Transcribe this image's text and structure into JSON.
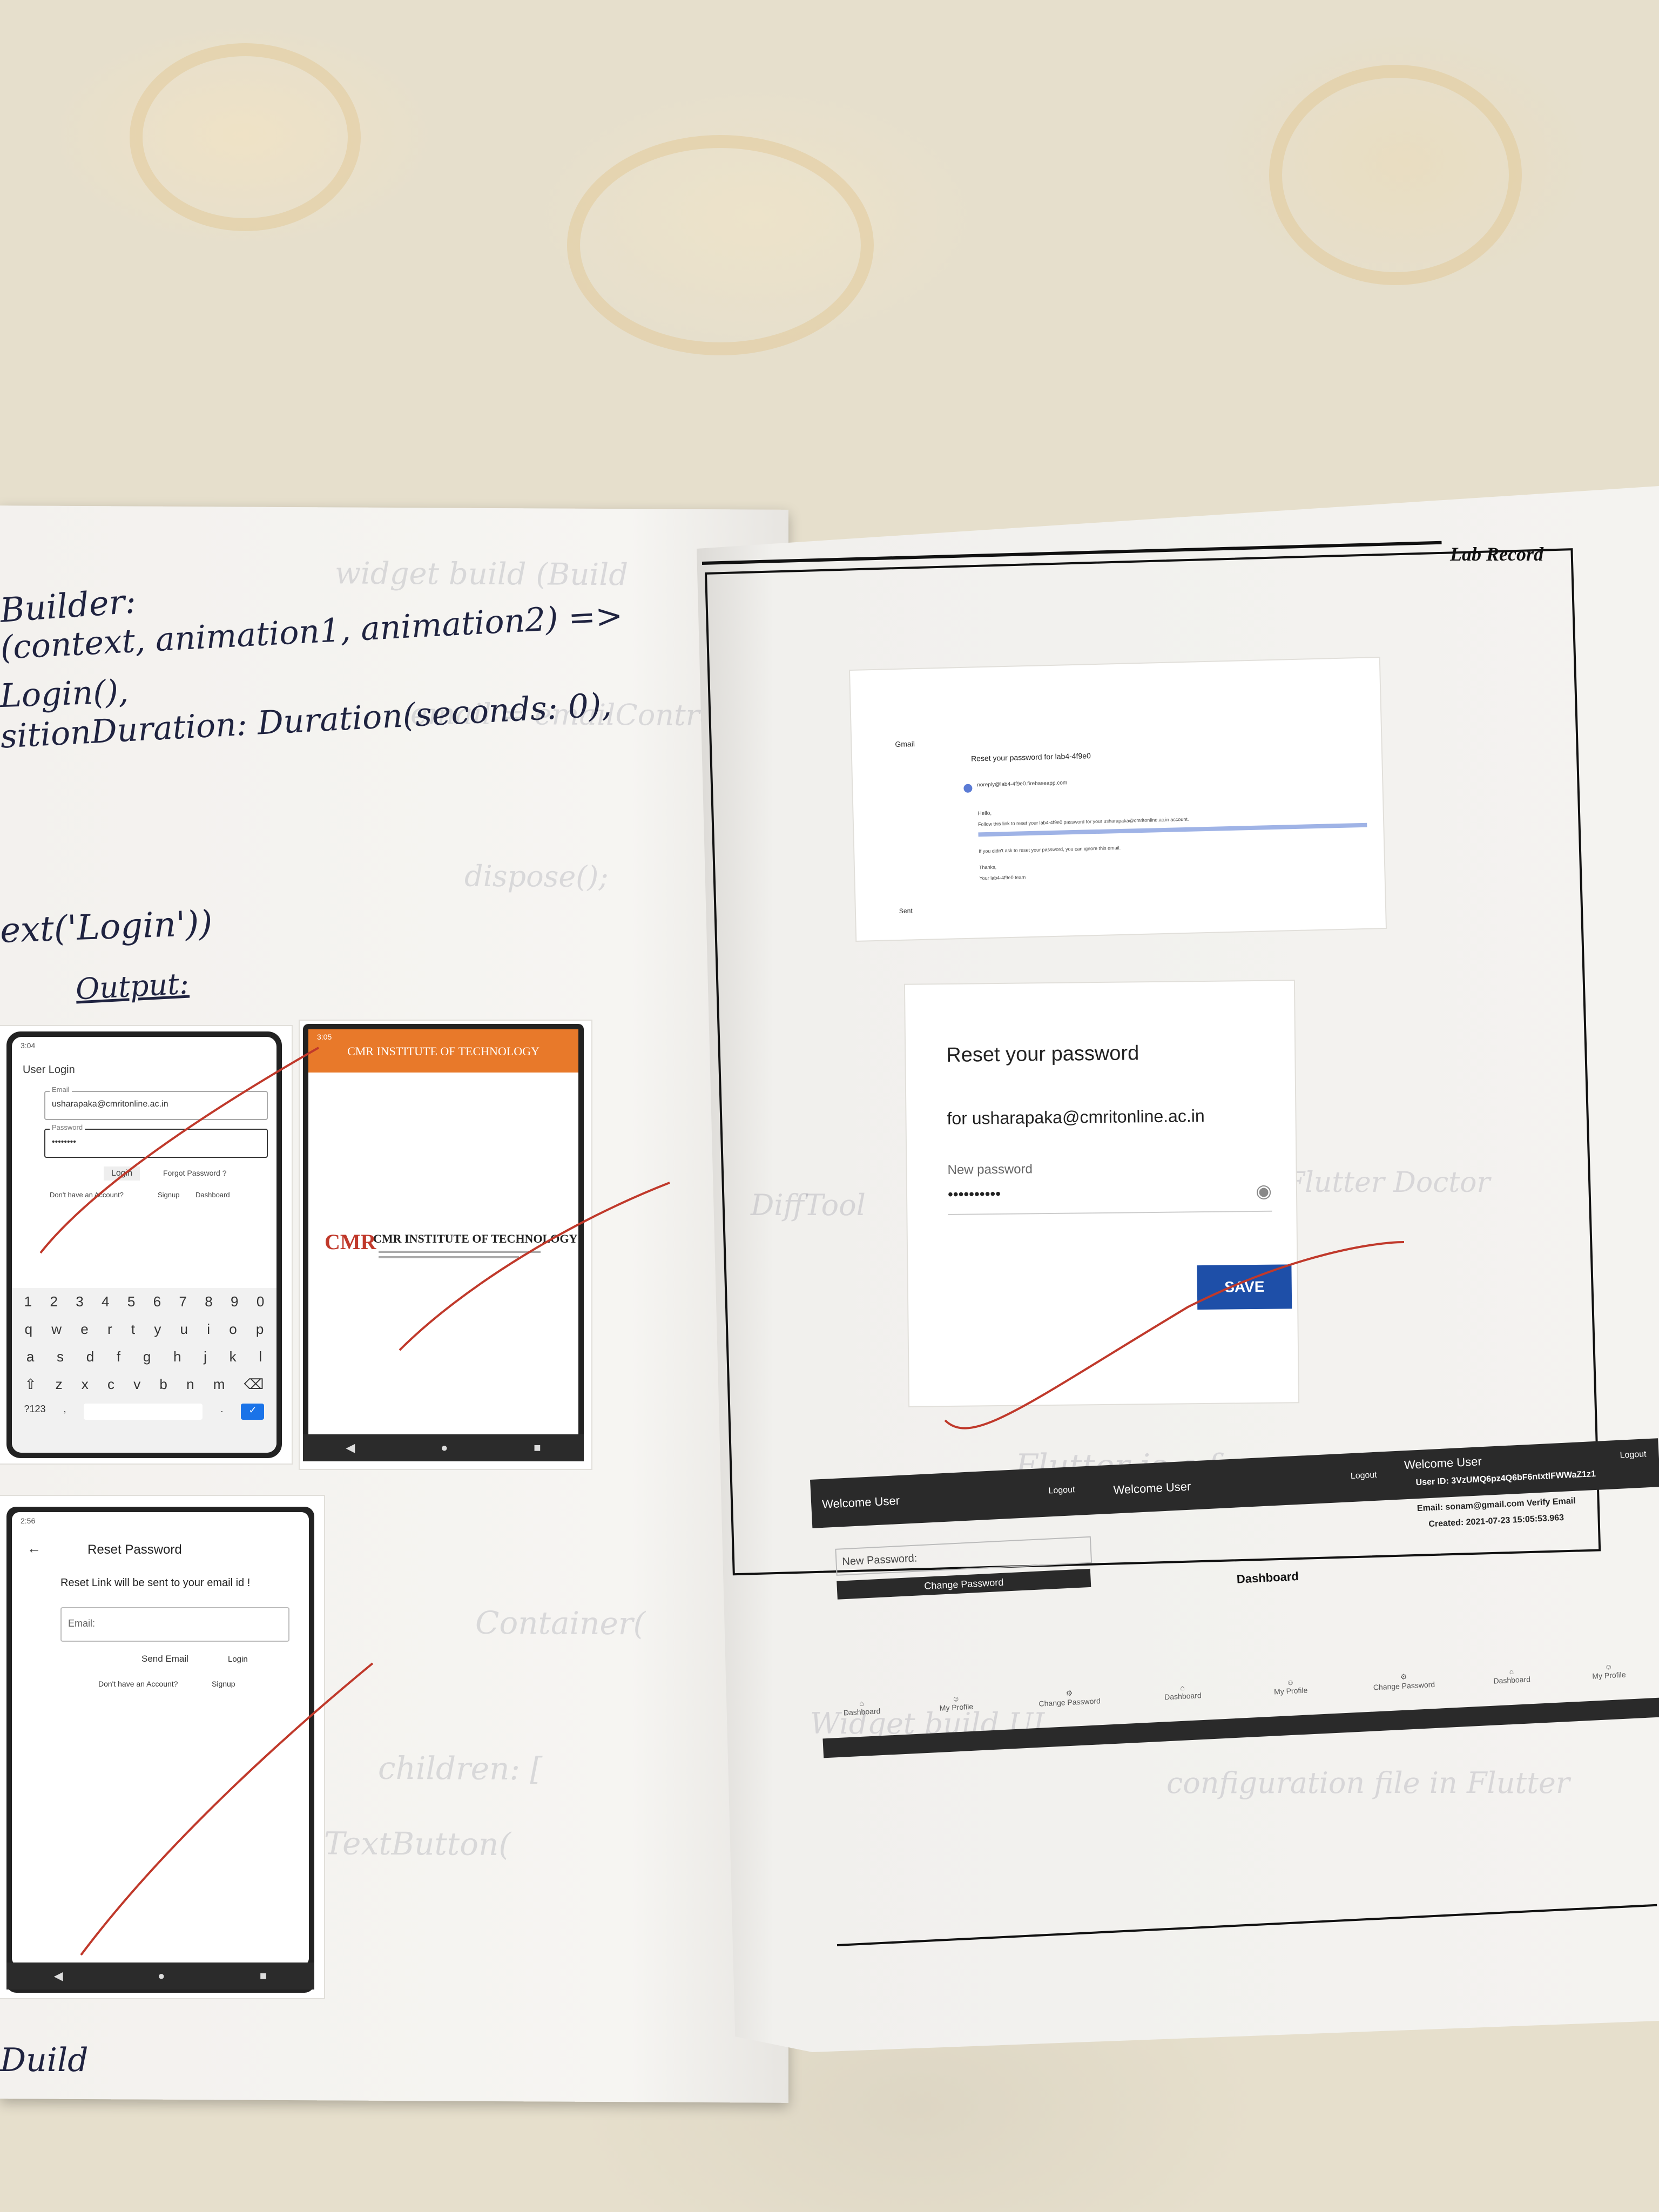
{
  "left_page": {
    "code_lines": [
      "Builder:",
      "(context, animation1, animation2) =>",
      "Login(),",
      "sitionDuration: Duration(seconds: 0),"
    ],
    "code_tail": "ext('Login'))",
    "output_heading": "Output:",
    "bottom_cutoff": "Duild",
    "login_screen": {
      "status_time": "3:04",
      "title": "User Login",
      "email_label": "Email",
      "email_value": "usharapaka@cmritonline.ac.in",
      "password_label": "Password",
      "password_value": "••••••••",
      "login_label": "Login",
      "forgot_label": "Forgot Password ?",
      "no_account": "Don't have an Account?",
      "signup": "Signup",
      "dashboard": "Dashboard",
      "key_rows": [
        [
          "1",
          "2",
          "3",
          "4",
          "5",
          "6",
          "7",
          "8",
          "9",
          "0"
        ],
        [
          "q",
          "w",
          "e",
          "r",
          "t",
          "y",
          "u",
          "i",
          "o",
          "p"
        ],
        [
          "a",
          "s",
          "d",
          "f",
          "g",
          "h",
          "j",
          "k",
          "l"
        ],
        [
          "⇧",
          "z",
          "x",
          "c",
          "v",
          "b",
          "n",
          "m",
          "⌫"
        ],
        [
          "?123",
          ",",
          "",
          "",
          "",
          "",
          "",
          ".",
          "✓"
        ]
      ]
    },
    "cmr_screen": {
      "status_time": "3:05",
      "appbar_title": "CMR INSTITUTE OF TECHNOLOGY",
      "logo_text": "CMR",
      "institute_name": "CMR INSTITUTE OF TECHNOLOGY"
    },
    "reset_screen": {
      "status_time": "2:56",
      "title": "Reset Password",
      "subtitle": "Reset Link will be sent to your email id !",
      "email_placeholder": "Email:",
      "send_email": "Send Email",
      "login": "Login",
      "no_account": "Don't have an Account?",
      "signup": "Signup"
    }
  },
  "right_page": {
    "header": "Lab Record",
    "gmail": {
      "app": "Gmail",
      "subject": "Reset your password for lab4-4f9e0",
      "sender": "noreply@lab4-4f9e0.firebaseapp.com",
      "body_hello": "Hello,",
      "body_line1": "Follow this link to reset your lab4-4f9e0 password for your usharapaka@cmritonline.ac.in account.",
      "body_line2": "If you didn't ask to reset your password, you can ignore this email.",
      "thanks": "Thanks,",
      "team": "Your lab4-4f9e0 team",
      "side_label": "Sent"
    },
    "reset_dialog": {
      "title": "Reset your password",
      "for_prefix": "for",
      "email": "usharapaka@cmritonline.ac.in",
      "field_label": "New password",
      "field_value": "••••••••••",
      "save": "SAVE"
    },
    "strip": {
      "welcome_1": "Welcome User",
      "logout_1": "Logout",
      "welcome_2": "Welcome User",
      "logout_2": "Logout",
      "welcome_3": "Welcome User",
      "logout_3": "Logout",
      "new_password": "New Password:",
      "change_password": "Change Password",
      "dashboard_title": "Dashboard",
      "user_id": "User ID: 3VzUMQ6pz4Q6bF6ntxtlFWWaZ1z1",
      "email": "Email: sonam@gmail.com  Verify Email",
      "created": "Created: 2021-07-23 15:05:53.963",
      "nav_a": [
        "Dashboard",
        "My Profile",
        "Change Password"
      ],
      "nav_b": [
        "Dashboard",
        "My Profile",
        "Change Password"
      ],
      "nav_c": [
        "Dashboard",
        "My Profile"
      ]
    }
  },
  "colors": {
    "ink": "#1f2340",
    "red_tick": "#c0392b",
    "cmr_orange": "#e8792a",
    "save_blue": "#1e4fa8",
    "strip_dark": "#2a2a2a"
  }
}
